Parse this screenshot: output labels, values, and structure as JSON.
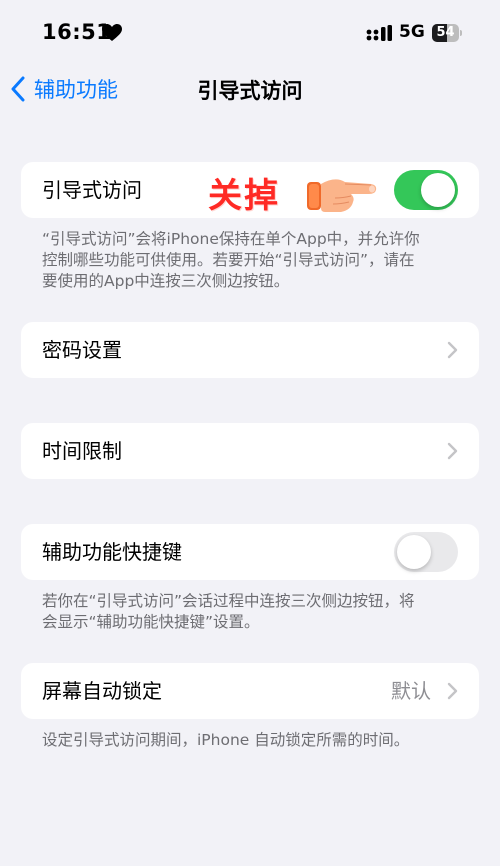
{
  "status_bar": {
    "time": "16:51",
    "heart_icon": "heart-icon",
    "signal_icon": "cellular-signal-icon",
    "network": "5G",
    "battery_level": "54",
    "battery_fraction": 0.54
  },
  "nav": {
    "back_label": "辅助功能",
    "title": "引导式访问"
  },
  "guided_access": {
    "label": "引导式访问",
    "toggle_on": true,
    "annotation": "关掉",
    "footer_lines": [
      "“引导式访问”会将iPhone保持在单个App中，并允许你",
      "控制哪些功能可供使用。若要开始“引导式访问”，请在",
      "要使用的App中连按三次侧边按钮。"
    ]
  },
  "passcode": {
    "label": "密码设置"
  },
  "time_limits": {
    "label": "时间限制"
  },
  "accessibility_shortcut": {
    "label": "辅助功能快捷键",
    "toggle_on": false,
    "footer_lines": [
      "若你在“引导式访问”会话过程中连按三次侧边按钮，将",
      "会显示“辅助功能快捷键”设置。"
    ]
  },
  "auto_lock": {
    "label": "屏幕自动锁定",
    "value": "默认",
    "footer": "设定引导式访问期间，iPhone 自动锁定所需的时间。"
  },
  "colors": {
    "accent": "#0a7aff",
    "toggle_on": "#34c759",
    "annotation": "#ff2a25",
    "background": "#f2f2f7"
  }
}
